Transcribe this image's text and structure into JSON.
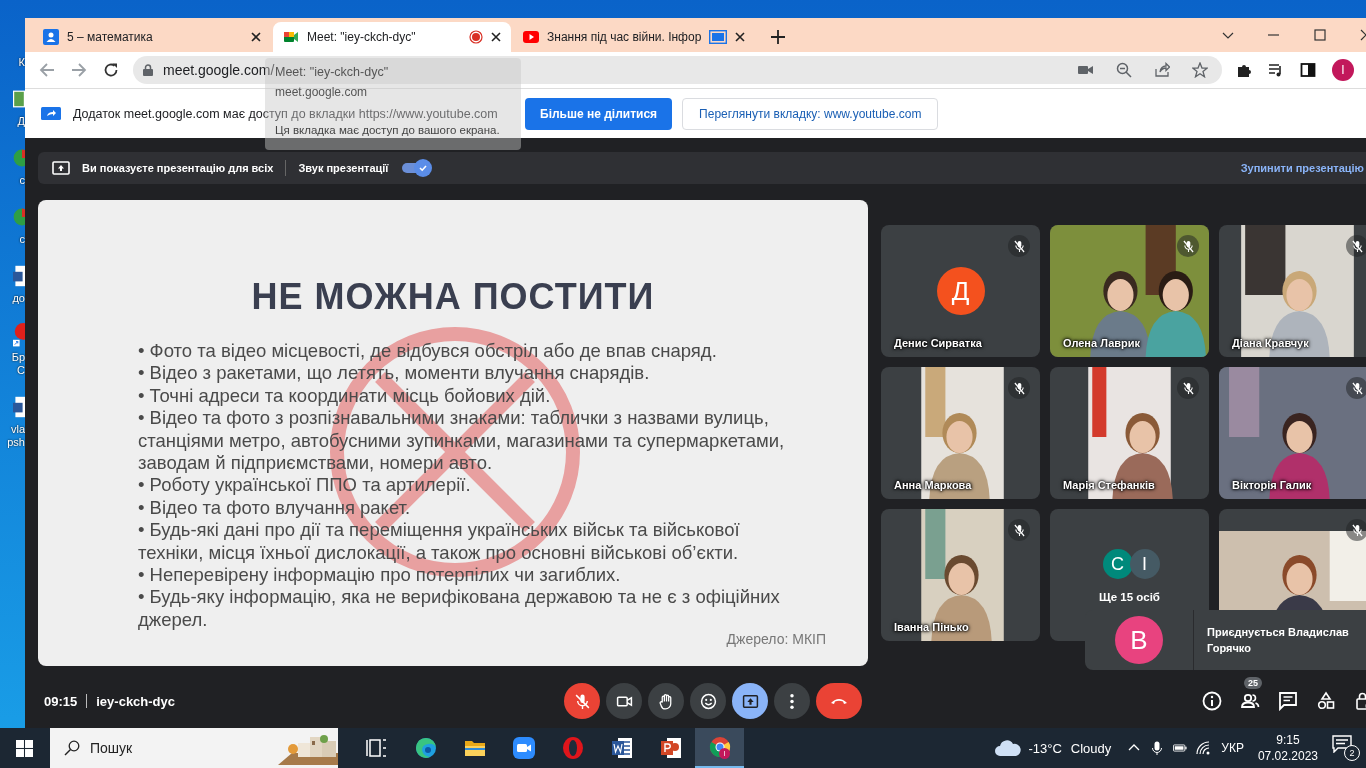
{
  "desktop_icons": [
    {
      "kind": "none",
      "label": "К"
    },
    {
      "label": "Д"
    },
    {
      "kind": "ball",
      "label": "с"
    },
    {
      "kind": "ball",
      "label": "с"
    },
    {
      "kind": "word",
      "label": "до"
    },
    {
      "kind": "red-ball",
      "label": "Бр С"
    },
    {
      "kind": "word",
      "label": "vla psh"
    }
  ],
  "tabs": [
    {
      "title": "5 – математика",
      "selected": false,
      "recording": false,
      "sharing": false
    },
    {
      "title": "Meet: \"iey-ckch-dyc\"",
      "selected": true,
      "recording": true,
      "sharing": false
    },
    {
      "title": "Знання під час війни. Інфор",
      "selected": false,
      "recording": false,
      "sharing": true
    }
  ],
  "address_bar": {
    "url": "meet.google.com/"
  },
  "tooltip": {
    "title": "Meet: \"iey-ckch-dyc\"",
    "domain": "meet.google.com",
    "note": "Ця вкладка має доступ до вашого екрана."
  },
  "profile": {
    "initial": "I"
  },
  "infobar": {
    "message": "Додаток meet.google.com має доступ до вкладки https://www.youtube.com",
    "primary_button": "Більше не ділитися",
    "secondary_button": "Переглянути вкладку: www.youtube.com"
  },
  "presentation_bar": {
    "status": "Ви показуєте презентацію для всіх",
    "sound_label": "Звук презентації",
    "sound_on": true,
    "stop": "Зупинити презентацію"
  },
  "slide": {
    "title": "НЕ МОЖНА ПОСТИТИ",
    "bullets": [
      "• Фото та відео місцевості, де відбувся обстріл або де впав снаряд.",
      "• Відео з ракетами, що летять, моменти влучання снарядів.",
      "• Точні адреси та координати місць бойових дій.",
      "• Відео та фото з розпізнавальними знаками: таблички з назвами вулиць, станціями метро, автобусними зупинками, магазинами та супермаркетами, заводам й підприємствами, номери авто.",
      "• Роботу української ППО та артилерії.",
      "• Відео та фото влучання ракет.",
      "• Будь-які дані про дії та переміщення українських військ та військової техніки, місця їхньої дислокації, а також про основні військові об’єкти.",
      "• Неперевірену інформацію про потерпілих чи загиблих.",
      "• Будь-яку інформацію, яка не верифікована державою та не є з офіційних джерел."
    ],
    "source": "Джерело: МКІП"
  },
  "tiles": [
    {
      "kind": "avatar",
      "name": "Денис Сирватка",
      "initial": "Д",
      "color": "#f4511e",
      "muted": true
    },
    {
      "kind": "video",
      "name": "Олена Лаврик",
      "muted": true
    },
    {
      "kind": "video",
      "name": "Діана Кравчук",
      "muted": true
    },
    {
      "kind": "video",
      "name": "Анна Маркова",
      "muted": true
    },
    {
      "kind": "video",
      "name": "Марія Стефанків",
      "muted": true
    },
    {
      "kind": "video",
      "name": "Вікторія Галик",
      "muted": true
    },
    {
      "kind": "video",
      "name": "Іванна Пінько",
      "muted": true
    },
    {
      "kind": "more",
      "name": "Ще 15 осіб",
      "muted": false,
      "avatars": [
        {
          "initial": "С",
          "color": "#00897b"
        },
        {
          "initial": "І",
          "color": "#455a64"
        }
      ]
    },
    {
      "kind": "video",
      "muted": true
    }
  ],
  "toast": {
    "initial": "В",
    "color": "#e8437f",
    "text": "Приєднується Владислав Горячко"
  },
  "meeting": {
    "time": "09:15",
    "code": "iey-ckch-dyc"
  },
  "controls": [
    {
      "kind": "mic",
      "on": false
    },
    {
      "kind": "camera",
      "on": true
    },
    {
      "kind": "hand"
    },
    {
      "kind": "emoji"
    },
    {
      "kind": "present",
      "on": true
    },
    {
      "kind": "more"
    },
    {
      "kind": "hangup"
    }
  ],
  "side_buttons": [
    {
      "kind": "info"
    },
    {
      "kind": "people",
      "badge": "25"
    },
    {
      "kind": "chat"
    },
    {
      "kind": "activities"
    },
    {
      "kind": "host"
    }
  ],
  "taskbar": {
    "search_placeholder": "Пошук",
    "apps": [
      {
        "kind": "task-view",
        "active": false
      },
      {
        "kind": "edge",
        "active": false
      },
      {
        "kind": "explorer",
        "active": false
      },
      {
        "kind": "zoom",
        "active": false
      },
      {
        "kind": "opera",
        "active": false
      },
      {
        "kind": "word",
        "active": false
      },
      {
        "kind": "powerpoint",
        "active": false
      },
      {
        "kind": "chrome",
        "active": true,
        "badge": "I"
      }
    ],
    "weather": {
      "temp": "-13°C",
      "condition": "Cloudy"
    },
    "language": "УКР",
    "time": "9:15",
    "date": "07.02.2023",
    "notifications": "2"
  }
}
